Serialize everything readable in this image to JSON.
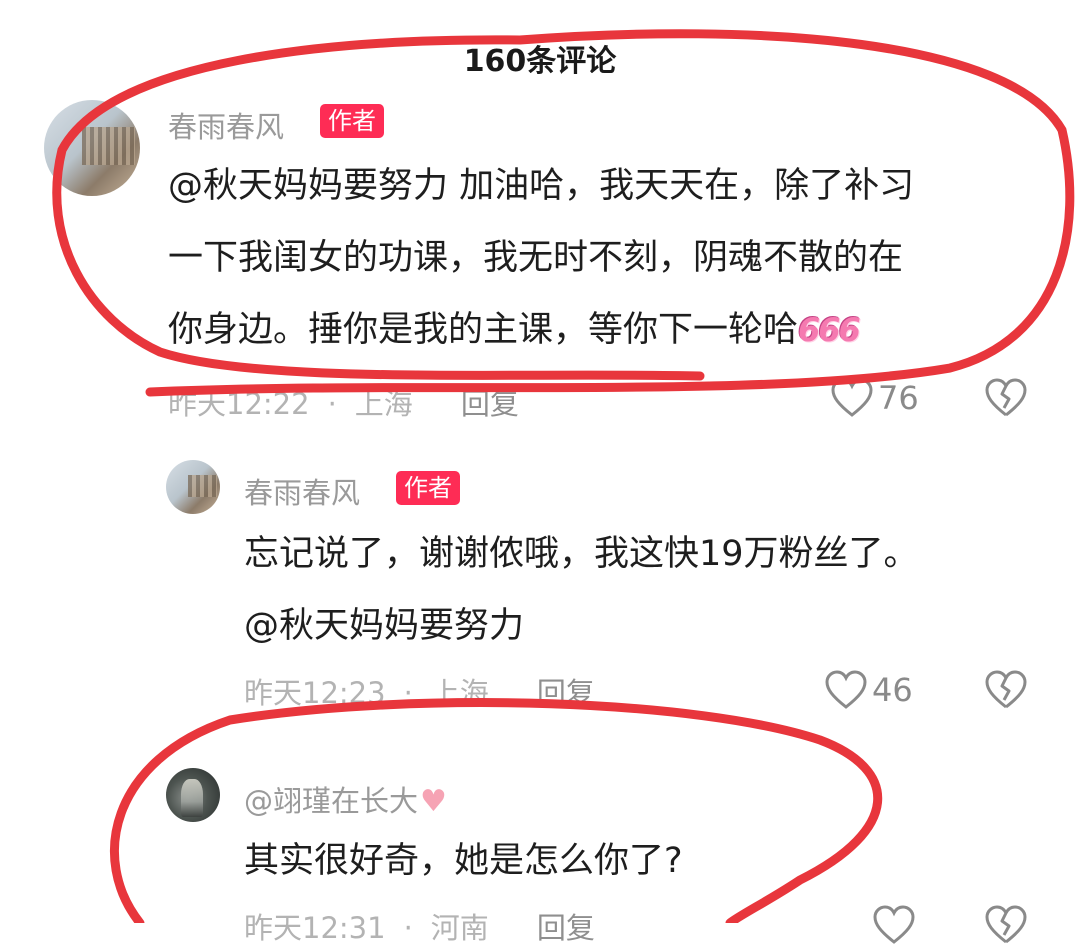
{
  "header": {
    "comment_count_title": "160条评论"
  },
  "comments": [
    {
      "username": "春雨春风",
      "badge": "作者",
      "lines": [
        "@秋天妈妈要努力 加油哈，我天天在，除了补习",
        "一下我闺女的功课，我无时不刻，阴魂不散的在",
        "你身边。捶你是我的主课，等你下一轮哈"
      ],
      "emoji_text": "666",
      "time": "昨天12:22",
      "location": "上海",
      "reply_label": "回复",
      "likes": "76"
    },
    {
      "username": "春雨春风",
      "badge": "作者",
      "lines": [
        "忘记说了，谢谢侬哦，我这快19万粉丝了。",
        "@秋天妈妈要努力"
      ],
      "time": "昨天12:23",
      "location": "上海",
      "reply_label": "回复",
      "likes": "46"
    },
    {
      "username": "@翊瑾在长大",
      "username_suffix_icon": "pink-heart-icon",
      "lines": [
        "其实很好奇，她是怎么你了?"
      ],
      "time": "昨天12:31",
      "location": "河南",
      "reply_label": "回复"
    }
  ],
  "colors": {
    "author_badge": "#fe2c55",
    "annotation_red": "#e8363c",
    "meta_gray": "#b3b3b3"
  }
}
